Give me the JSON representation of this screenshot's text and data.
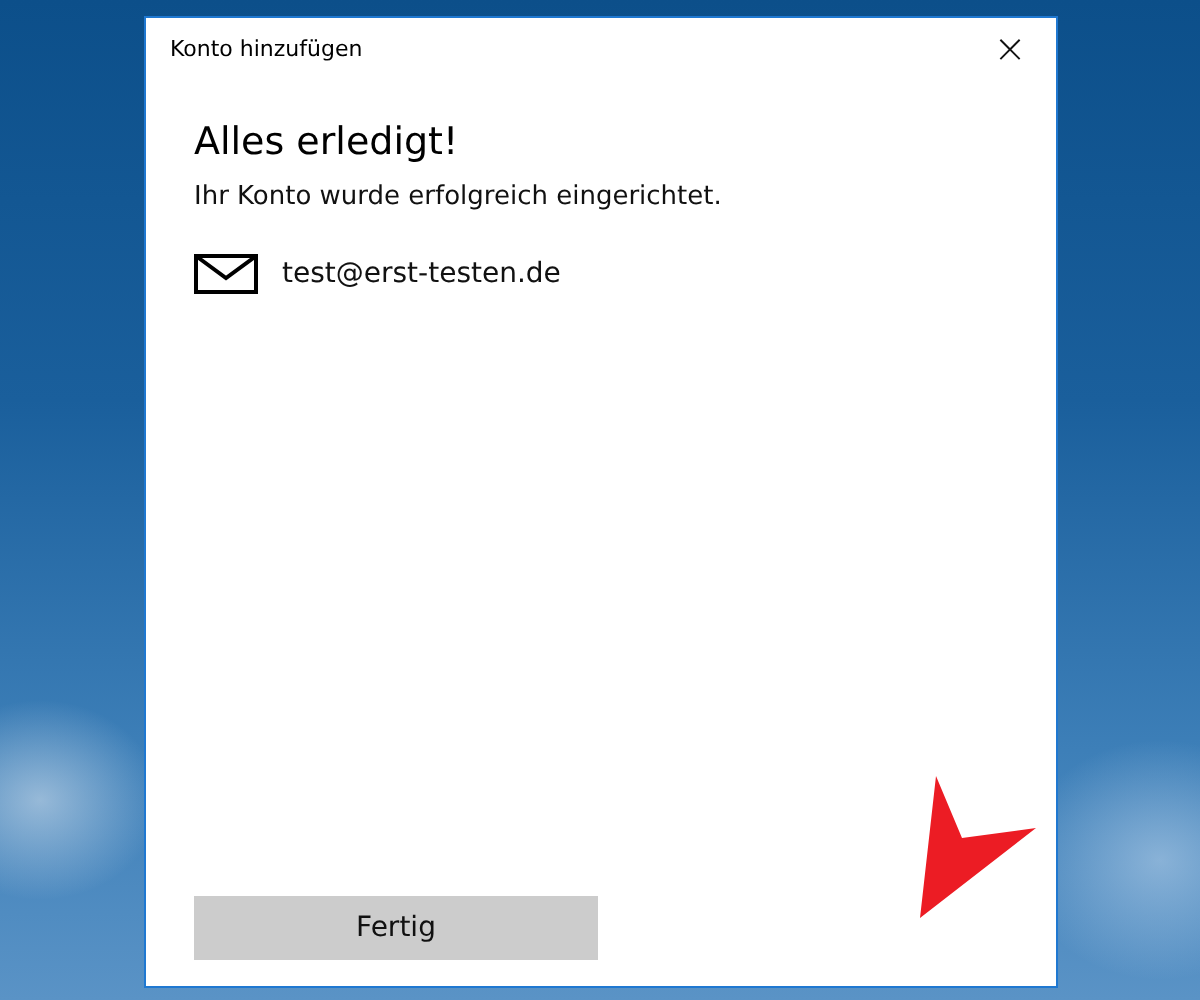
{
  "window": {
    "title": "Konto hinzufügen",
    "close": "×"
  },
  "heading": "Alles erledigt!",
  "message": "Ihr Konto wurde erfolgreich eingerichtet.",
  "account": {
    "email": "test@erst-testen.de"
  },
  "buttons": [
    "Fertig"
  ]
}
